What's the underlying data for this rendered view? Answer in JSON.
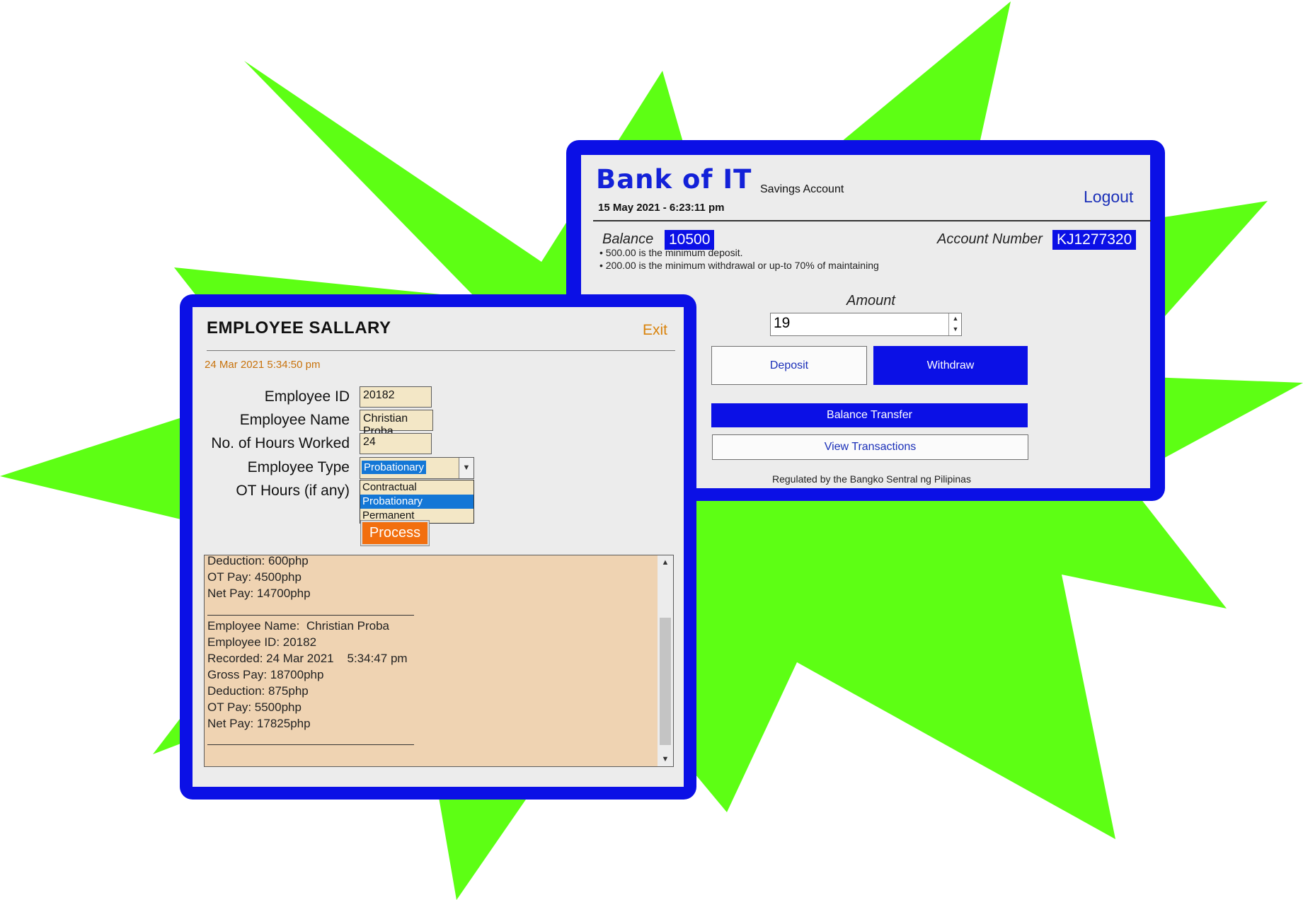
{
  "bank": {
    "title": "Bank of IT",
    "subtitle": "Savings Account",
    "datetime": "15 May 2021 - 6:23:11 pm",
    "logout": "Logout",
    "balance_label": "Balance",
    "balance_value": "10500",
    "account_label": "Account Number",
    "account_value": "KJ1277320",
    "notes": [
      "• 500.00 is the minimum deposit.",
      "• 200.00 is the minimum withdrawal or up-to 70% of maintaining"
    ],
    "amount_label": "Amount",
    "amount_value": "19",
    "deposit_label": "Deposit",
    "withdraw_label": "Withdraw",
    "transfer_label": "Balance Transfer",
    "transactions_label": "View Transactions",
    "footer": "Regulated by the Bangko Sentral ng Pilipinas",
    "colors": {
      "accent": "#0b10e6",
      "panel": "#ececec"
    }
  },
  "salary": {
    "title": "EMPLOYEE SALLARY",
    "exit": "Exit",
    "datetime": "24 Mar 2021   5:34:50 pm",
    "labels": {
      "employee_id": "Employee ID",
      "employee_name": "Employee Name",
      "hours": "No. of Hours Worked",
      "type": "Employee Type",
      "ot": "OT Hours (if any)"
    },
    "values": {
      "employee_id": "20182",
      "employee_name": "Christian Proba",
      "hours": "24",
      "type": "Probationary"
    },
    "type_options": [
      "Contractual",
      "Probationary",
      "Permanent"
    ],
    "process": "Process",
    "output_lines_top": [
      "Deduction: 600php",
      "OT Pay: 4500php",
      "Net Pay: 14700php"
    ],
    "output_lines": [
      "Employee Name:  Christian Proba",
      "Employee ID: 20182",
      "Recorded: 24 Mar 2021    5:34:47 pm",
      "Gross Pay: 18700php",
      "Deduction: 875php",
      "OT Pay: 5500php",
      "Net Pay: 17825php"
    ],
    "colors": {
      "accent": "#f26f0f",
      "field": "#f3e7c6",
      "output": "#efd3b2"
    }
  },
  "background": {
    "burst_color": "#5dff14"
  }
}
